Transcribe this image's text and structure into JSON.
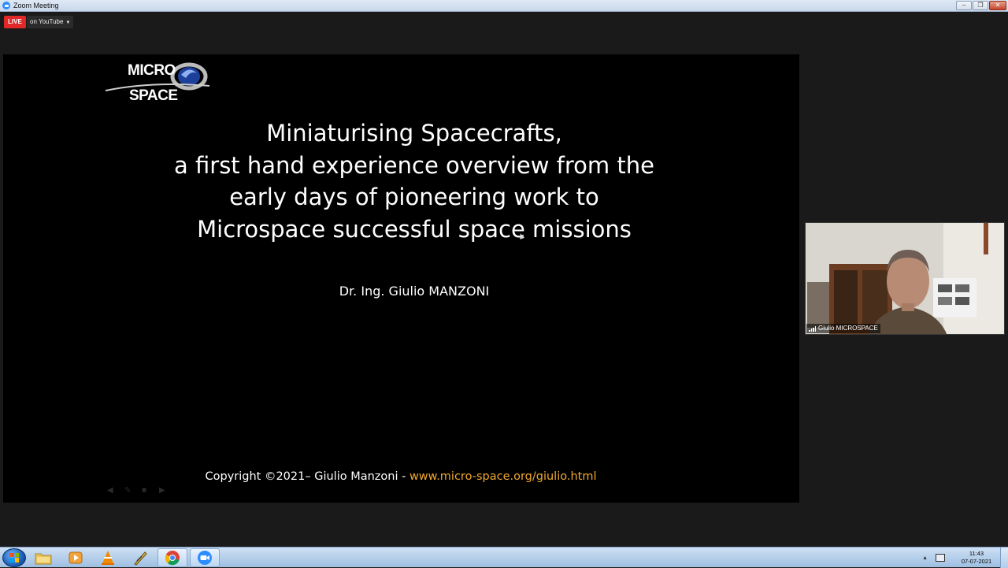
{
  "window": {
    "title": "Zoom Meeting",
    "minimize": "–",
    "restore": "❐",
    "close": "✕"
  },
  "livestream": {
    "badge": "LIVE",
    "target": "on YouTube",
    "caret": "▼"
  },
  "slide": {
    "logo_line1": "MICRO",
    "logo_line2": "SPACE",
    "title_lines": [
      "Miniaturising Spacecrafts,",
      "a first hand experience overview from the",
      "early days of pioneering work to",
      "Microspace successful space missions"
    ],
    "author": "Dr. Ing. Giulio MANZONI",
    "footer_text": "Copyright ©2021– Giulio Manzoni - ",
    "footer_link": "www.micro-space.org/giulio.html",
    "link_color": "#f0a830"
  },
  "participant": {
    "name": "Giulio MICROSPACE"
  },
  "taskbar": {
    "items": [
      "windows-explorer",
      "media-player",
      "vlc",
      "mail-app",
      "chrome",
      "zoom"
    ],
    "clock_time": "11:43",
    "clock_date": "07-07-2021"
  }
}
